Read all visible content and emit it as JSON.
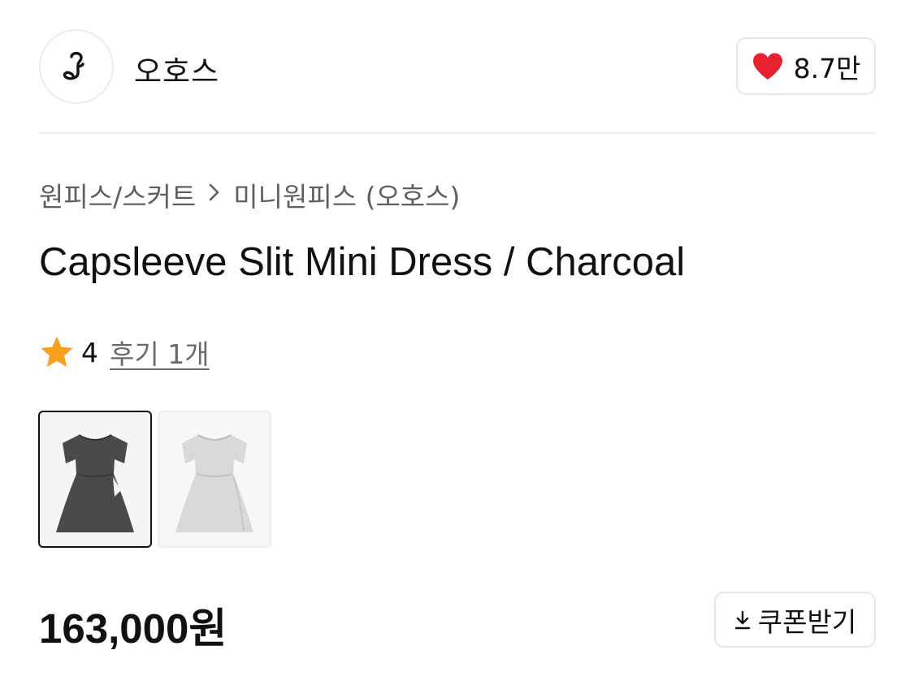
{
  "brand": {
    "name": "오호스",
    "logo_icon": "music-note-logo-icon"
  },
  "like": {
    "icon": "heart-icon",
    "color": "#e8212e",
    "count": "8.7만"
  },
  "breadcrumb": {
    "category": "원피스/스커트",
    "separator_icon": "chevron-right-icon",
    "subcategory": "미니원피스 (오호스)"
  },
  "product": {
    "title": "Capsleeve Slit Mini Dress / Charcoal"
  },
  "rating": {
    "icon": "star-icon",
    "star_color": "#f7a01b",
    "score": "4",
    "reviews_label": "후기 1개"
  },
  "thumbnails": [
    {
      "color": "charcoal",
      "selected": true
    },
    {
      "color": "light-gray",
      "selected": false
    }
  ],
  "price": {
    "value": "163,000원"
  },
  "coupon": {
    "icon": "download-arrow-icon",
    "label": "쿠폰받기"
  }
}
